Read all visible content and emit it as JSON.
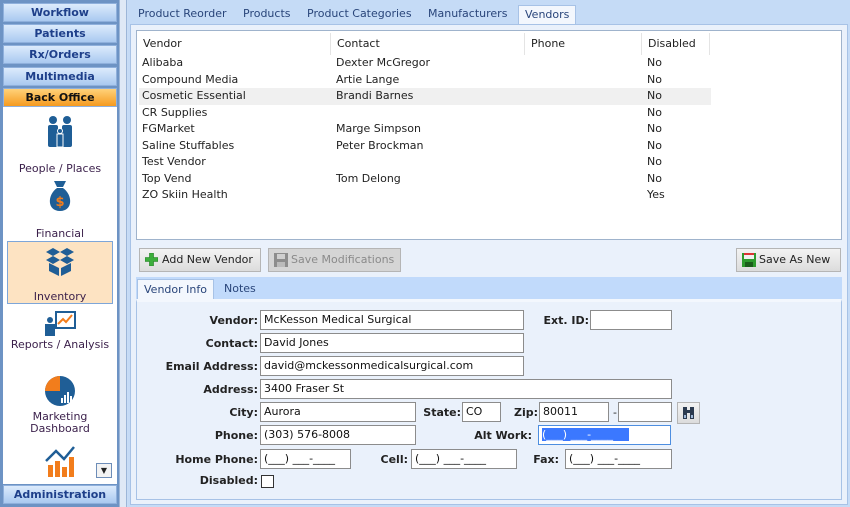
{
  "sidebar": {
    "bands": [
      "Workflow",
      "Patients",
      "Rx/Orders",
      "Multimedia",
      "Back Office"
    ],
    "active_band": "Back Office",
    "footer": "Administration",
    "items": [
      {
        "label": "People / Places",
        "icon": "people-icon"
      },
      {
        "label": "Financial",
        "icon": "money-bag-icon"
      },
      {
        "label": "Inventory",
        "icon": "boxes-icon",
        "selected": true
      },
      {
        "label": "Reports / Analysis",
        "icon": "presentation-icon"
      },
      {
        "label": "Marketing Dashboard",
        "icon": "pie-chart-icon"
      },
      {
        "label": "",
        "icon": "bar-chart-icon"
      }
    ]
  },
  "tabs": [
    "Product Reorder",
    "Products",
    "Product Categories",
    "Manufacturers",
    "Vendors"
  ],
  "active_tab": "Vendors",
  "grid": {
    "columns": [
      "Vendor",
      "Contact",
      "Phone",
      "Disabled"
    ],
    "rows": [
      [
        "Alibaba",
        "Dexter McGregor",
        "",
        "No"
      ],
      [
        "Compound Media",
        "Artie Lange",
        "",
        "No"
      ],
      [
        "Cosmetic Essential",
        "Brandi Barnes",
        "",
        "No"
      ],
      [
        "CR Supplies",
        "",
        "",
        "No"
      ],
      [
        "FGMarket",
        "Marge Simpson",
        "",
        "No"
      ],
      [
        "Saline Stuffables",
        "Peter Brockman",
        "",
        "No"
      ],
      [
        "Test Vendor",
        "",
        "",
        "No"
      ],
      [
        "Top Vend",
        "Tom Delong",
        "",
        "No"
      ],
      [
        "ZO Skiin Health",
        "",
        "",
        "Yes"
      ]
    ],
    "selected_row": 2
  },
  "buttons": {
    "add": "Add New Vendor",
    "save_mod": "Save Modifications",
    "save_new": "Save As New"
  },
  "subtabs": [
    "Vendor Info",
    "Notes"
  ],
  "form": {
    "vendor_label": "Vendor:",
    "vendor": "McKesson Medical Surgical",
    "extid_label": "Ext. ID:",
    "extid": "",
    "contact_label": "Contact:",
    "contact": "David Jones",
    "email_label": "Email Address:",
    "email": "david@mckessonmedicalsurgical.com",
    "address_label": "Address:",
    "address": "3400 Fraser St",
    "city_label": "City:",
    "city": "Aurora",
    "state_label": "State:",
    "state": "CO",
    "zip_label": "Zip:",
    "zip": "80011",
    "zip_dash": "-",
    "zip4": "",
    "phone_label": "Phone:",
    "phone": "(303) 576-8008",
    "altwork_label": "Alt Work:",
    "altwork": "(___) ___-____",
    "home_label": "Home Phone:",
    "home": "(___) ___-____",
    "cell_label": "Cell:",
    "cell": "(___) ___-____",
    "fax_label": "Fax:",
    "fax": "(___) ___-____",
    "disabled_label": "Disabled:",
    "disabled": false
  },
  "colors": {
    "accent_orange": "#f59a1f",
    "icon_blue": "#1f5e96",
    "tab_text": "#29457a"
  }
}
